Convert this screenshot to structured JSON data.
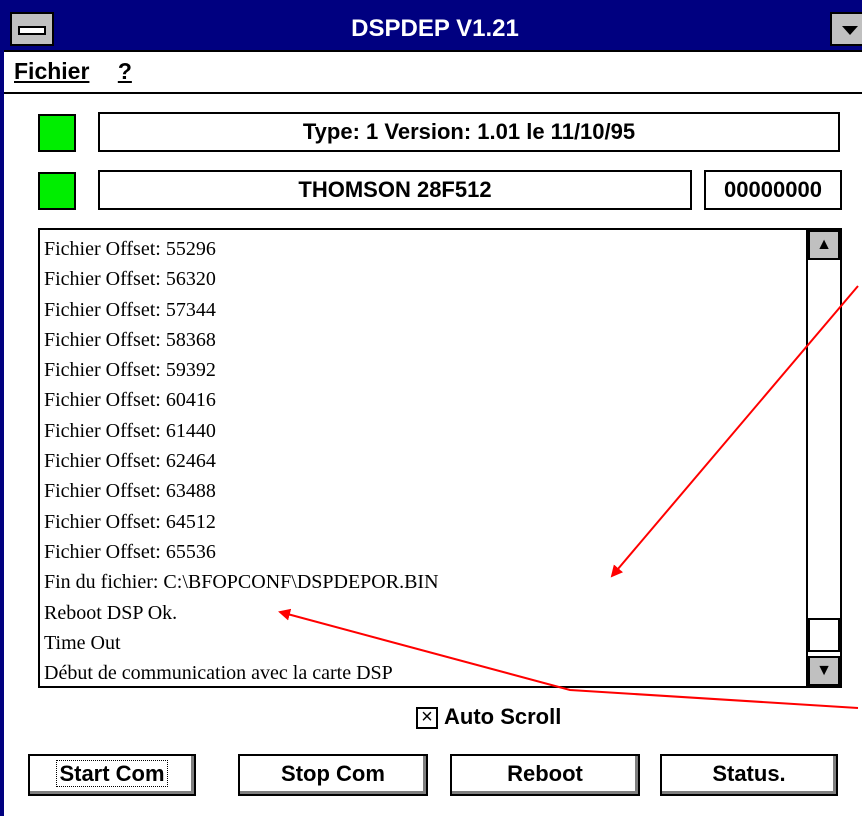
{
  "window": {
    "title": "DSPDEP V1.21"
  },
  "menu": {
    "items": [
      {
        "label": "Fichier"
      },
      {
        "label": "?"
      }
    ]
  },
  "status": {
    "version_text": "Type: 1 Version:  1.01 le 11/10/95",
    "device_text": "THOMSON 28F512",
    "counter": "00000000",
    "led_color": "#00ee00"
  },
  "log": {
    "lines": [
      "Fichier Offset: 55296",
      "Fichier Offset: 56320",
      "Fichier Offset: 57344",
      "Fichier Offset: 58368",
      "Fichier Offset: 59392",
      "Fichier Offset: 60416",
      "Fichier Offset: 61440",
      "Fichier Offset: 62464",
      "Fichier Offset: 63488",
      "Fichier Offset: 64512",
      "Fichier Offset: 65536",
      "Fin du fichier: C:\\BFOPCONF\\DSPDEPOR.BIN",
      "Reboot DSP Ok.",
      "Time Out",
      "Début de communication avec la carte DSP"
    ],
    "scroll_position": 0.9
  },
  "options": {
    "auto_scroll_label": "Auto Scroll",
    "auto_scroll_checked": true
  },
  "buttons": {
    "start": "Start Com",
    "stop": "Stop Com",
    "reboot": "Reboot",
    "status": "Status."
  },
  "annotation_color": "#ff0000"
}
